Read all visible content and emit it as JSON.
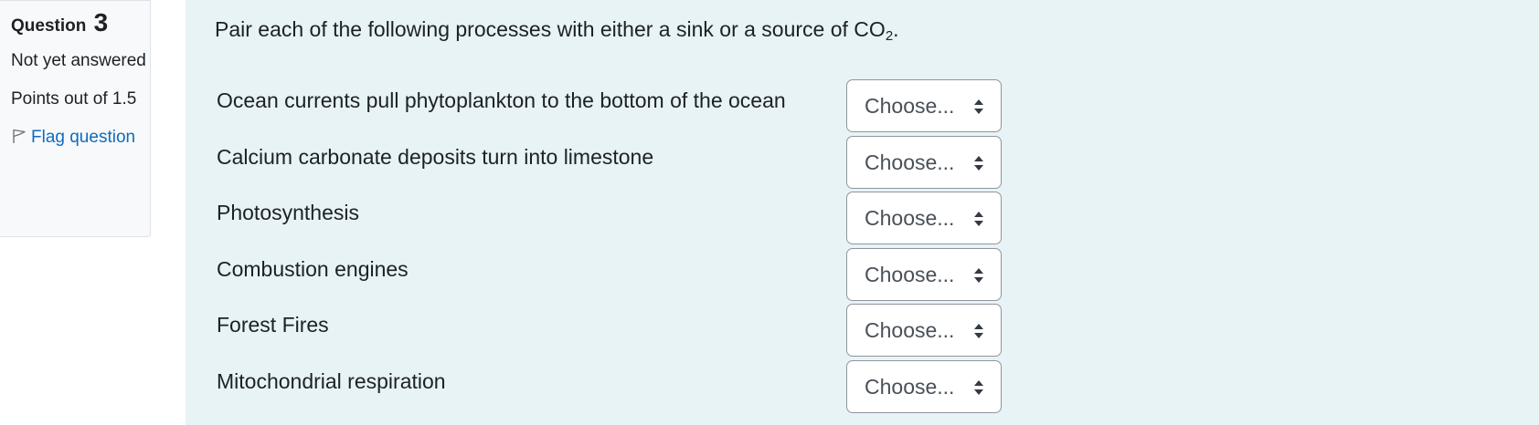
{
  "info": {
    "question_label": "Question",
    "question_number": "3",
    "state": "Not yet answered",
    "points": "Points out of 1.5",
    "flag_label": "Flag question",
    "flag_icon": "flag-icon"
  },
  "question": {
    "text_main": "Pair each of the following processes with either a sink or a source of CO",
    "text_subscript": "2",
    "text_end": "."
  },
  "matches": [
    {
      "label": "Ocean currents pull phytoplankton to the bottom of the ocean",
      "selected": "Choose..."
    },
    {
      "label": "Calcium carbonate deposits turn into limestone",
      "selected": "Choose..."
    },
    {
      "label": "Photosynthesis",
      "selected": "Choose..."
    },
    {
      "label": "Combustion engines",
      "selected": "Choose..."
    },
    {
      "label": "Forest Fires",
      "selected": "Choose..."
    },
    {
      "label": "Mitochondrial respiration",
      "selected": "Choose..."
    }
  ],
  "colors": {
    "content_background": "#e7f3f5",
    "info_background": "#f8f9fa",
    "link": "#0f6cbf",
    "text": "#1d2125"
  }
}
